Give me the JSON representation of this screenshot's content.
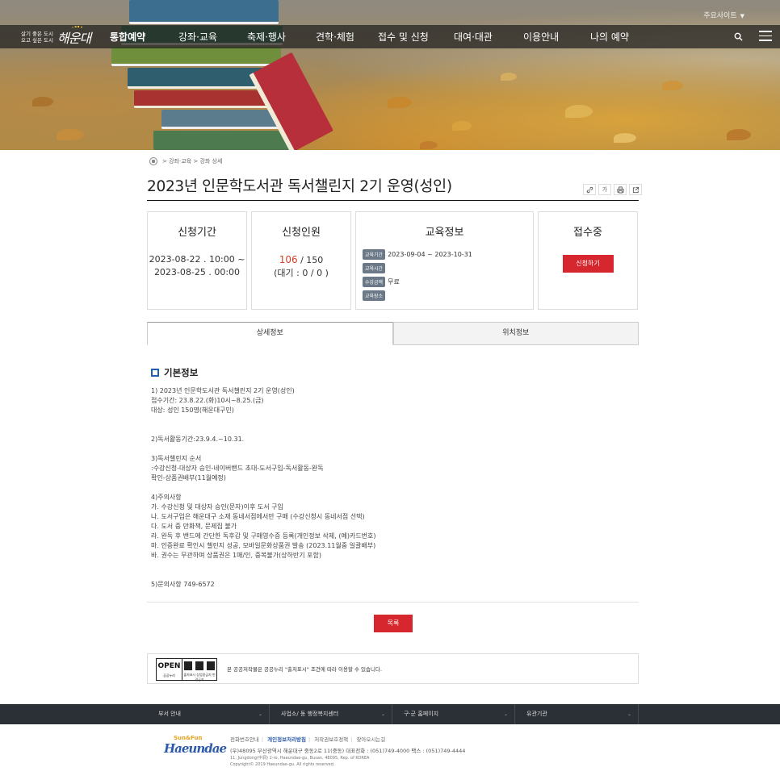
{
  "header": {
    "top_util": "주요사이트",
    "logo_tagline_1": "살기 좋은 도시",
    "logo_tagline_2": "오고 싶은 도시",
    "logo_text": "해운대",
    "nav": [
      "통합예약",
      "강좌·교육",
      "축제·행사",
      "견학·체험",
      "접수 및 신청",
      "대여·대관",
      "이용안내",
      "나의 예약"
    ]
  },
  "breadcrumb": {
    "section": "강좌·교육",
    "current": "강좌 상세",
    "separator": ">"
  },
  "page": {
    "title": "2023년 인문학도서관 독서챌린지 2기 운영(성인)",
    "tools": [
      "link-icon",
      "font-size-icon",
      "print-icon",
      "share-icon"
    ],
    "tool_font_label": "가"
  },
  "info": {
    "period_title": "신청기간",
    "period_start": "2023-08-22 . 10:00 ~",
    "period_end": "2023-08-25 . 00:00",
    "capacity_title": "신청인원",
    "applied": "106",
    "capacity_total": " / 150",
    "waiting": "(대기 : 0 / 0 )",
    "edu_title": "교육정보",
    "edu_rows": [
      {
        "tag": "교육기간",
        "value": "2023-09-04 ~ 2023-10-31"
      },
      {
        "tag": "교육시간",
        "value": ""
      },
      {
        "tag": "수강금액",
        "value": "무료"
      },
      {
        "tag": "교육장소",
        "value": ""
      }
    ],
    "status_title": "접수중",
    "apply_label": "신청하기"
  },
  "tabs": [
    "상세정보",
    "위치정보"
  ],
  "content": {
    "section_title": "기본정보",
    "lines": [
      "1) 2023년 인문학도서관 독서챌린지 2기 운영(성인)",
      "접수기간: 23.8.22.(화)10시~8.25.(금)",
      "대상: 성인 150명(해운대구민)",
      "",
      "",
      "2)독서활동기간:23.9.4.~10.31.",
      "",
      "3)독서챌린지 순서",
      ":수강신청-대상자 승인-네이버밴드 초대-도서구입-독서활동-완독",
      "확인-상품권배부(11월예정)",
      "",
      "4)주의사항",
      "가. 수강신청 및 대상자 승인(문자)이후 도서 구입",
      "나. 도서구입은 해운대구 소재 동네서점에서만 구매 (수강신청시 동네서점 선택)",
      "다. 도서 중 만화책, 문제집 불가",
      "라. 완독 후 밴드에 간단한 독후감 및 구매영수증 등록(개인정보 삭제, (예)카드번호)",
      "마. 인증완료 확인시 챌린지 성공, 모바일문화상품권 발송 (2023.11월중 일괄배부)",
      "바. 권수는 무관하며 상품권은 1매/인, 중복불가(상하반기 포함)",
      "",
      "",
      "5)문의사항 749-6572"
    ],
    "list_button": "목록"
  },
  "license": {
    "open_text": "OPEN",
    "open_sub": "공공누리",
    "open_type": "출처표시 상업용금지 변경금지",
    "text": "본 공공저작물은 공공누리 \"출처표시\" 조건에 따라 이용할 수 있습니다."
  },
  "footer": {
    "selects": [
      "부서 안내",
      "사업소/ 동 행정복지센터",
      "구·군 홈페이지",
      "유관기관"
    ],
    "logo_sub": "Sun&Fun",
    "logo_main": "Haeundae",
    "links": [
      "전화번호안내",
      "개인정보처리방침",
      "저작권보호정책",
      "찾아오시는길"
    ],
    "address": "(우)48095 부산광역시 해운대구 중동2로 11(중동)    대표전화 : (051)749-4000    팩스 : (051)749-4444",
    "address_en": "11, Jungdong(中洞) 2-ro, Haeundae-gu, Busan, 48095, Rep. of KOREA",
    "copyright": "Copyright© 2019 Haeundae-gu. All rights reserved."
  },
  "colors": {
    "accent_red": "#d6262e",
    "count_red": "#d0432c",
    "gnb_bg": "#1e1e1e",
    "footer_bar": "#2b3036",
    "section_blue": "#1f5fb5",
    "tag_gray": "#6b7887"
  }
}
